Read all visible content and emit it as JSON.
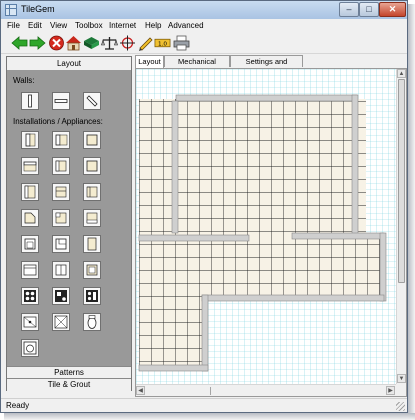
{
  "window": {
    "title": "TileGem"
  },
  "titlebar": {
    "minimize": "–",
    "maximize": "□",
    "close": "✕"
  },
  "menu": [
    "File",
    "Edit",
    "View",
    "Toolbox",
    "Internet",
    "Help",
    "Advanced"
  ],
  "toolbar": {
    "icons": [
      "back-arrow-icon",
      "forward-arrow-icon",
      "stop-icon",
      "home-icon",
      "tile-icon",
      "scale-icon",
      "crosshair-icon",
      "pencil-icon",
      "ruler-icon",
      "printer-icon"
    ],
    "ruler_label": "1.0"
  },
  "sidebar": {
    "header": "Layout",
    "walls_label": "Walls:",
    "installations_label": "Installations / Appliances:",
    "wall_tools": [
      "vertical-wall",
      "horizontal-wall",
      "diagonal-wall"
    ],
    "appliance_tools": [
      "cabinet-left",
      "cabinet-top-left",
      "cabinet-square",
      "counter-top",
      "sink-unit",
      "cabinet-plain",
      "cabinet-side",
      "cabinet-split",
      "cabinet-corner",
      "cabinet-angle",
      "cabinet-notch",
      "cabinet-bottom",
      "tub-left",
      "tub-corner",
      "cabinet-tall",
      "cabinet-wide",
      "cabinet-half",
      "cabinet-box",
      "range-four-burner",
      "range-grill",
      "range-oven",
      "shower-tray",
      "bath-square",
      "toilet-oval",
      "washbasin"
    ],
    "footer_tabs": [
      "Patterns",
      "Tile & Grout"
    ]
  },
  "tabs": [
    "Layout",
    "Mechanical Drawing",
    "Settings and Materials"
  ],
  "canvas": {
    "accent": "#7fd4e0",
    "tile_color": "#f7f2e6",
    "wall_color": "#cfcfcf"
  },
  "status": {
    "text": "Ready"
  }
}
